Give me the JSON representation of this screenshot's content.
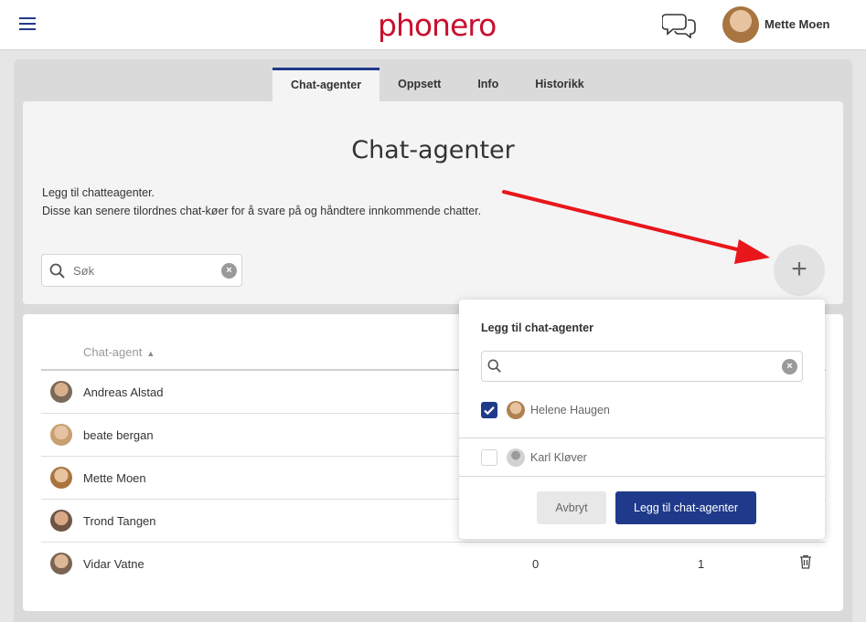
{
  "header": {
    "logo_text": "phonero",
    "user_name": "Mette Moen"
  },
  "tabs": [
    {
      "label": "Chat-agenter",
      "active": true
    },
    {
      "label": "Oppsett",
      "active": false
    },
    {
      "label": "Info",
      "active": false
    },
    {
      "label": "Historikk",
      "active": false
    }
  ],
  "page": {
    "title": "Chat-agenter",
    "desc_line1": "Legg til chatteagenter.",
    "desc_line2": "Disse kan senere tilordnes chat-køer for å svare på og håndtere innkommende chatter.",
    "search_placeholder": "Søk",
    "add_icon": "+"
  },
  "table": {
    "column_header": "Chat-agent",
    "rows": [
      {
        "name": "Andreas Alstad"
      },
      {
        "name": "beate bergan"
      },
      {
        "name": "Mette Moen"
      },
      {
        "name": "Trond Tangen"
      },
      {
        "name": "Vidar Vatne",
        "col1": "0",
        "col2": "1"
      }
    ]
  },
  "popup": {
    "title": "Legg til chat-agenter",
    "search_value": "",
    "options": [
      {
        "label": "Helene Haugen",
        "checked": true
      },
      {
        "label": "Karl Kløver",
        "checked": false
      }
    ],
    "cancel_label": "Avbryt",
    "add_label": "Legg til chat-agenter"
  },
  "icons": {
    "menu": "hamburger-menu-icon",
    "chat": "chat-bubbles-icon",
    "search": "search-icon",
    "clear": "clear-icon",
    "add": "plus-icon",
    "sort": "sort-ascending-icon",
    "delete": "trash-icon",
    "check": "checkmark-icon",
    "annotation": "red-arrow-annotation"
  },
  "colors": {
    "brand_red": "#c8102e",
    "primary_blue": "#1f3a8a",
    "annotation_red": "#e8171b"
  }
}
